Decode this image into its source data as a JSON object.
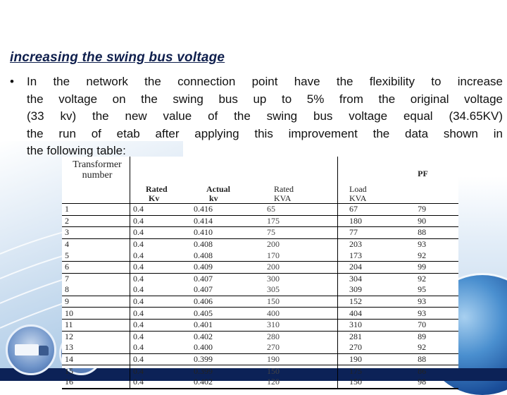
{
  "slide": {
    "title": "increasing the swing bus voltage",
    "bullet": {
      "symbol": "•",
      "lines": [
        "In the network the connection point have the flexibility to increase",
        "the voltage on the swing bus up to 5% from the original voltage",
        "(33 kv) the new value of the swing bus voltage equal (34.65KV)",
        "the run of etab after applying this improvement the data shown in",
        "the following table:"
      ]
    },
    "colors": {
      "title": "#0f1f4d",
      "bottom_band": "#0c2257"
    },
    "decorations": [
      "truck-badge",
      "globe",
      "light-arcs"
    ]
  },
  "table": {
    "headers": [
      {
        "line1": "Transformer",
        "line2": "number"
      },
      {
        "line1": "Rated",
        "line2": "Kv"
      },
      {
        "line1": "Actual",
        "line2": "kv"
      },
      {
        "line1": "Rated",
        "line2": "KVA"
      },
      {
        "line1": "Load",
        "line2": "KVA"
      },
      {
        "line1": "PF",
        "line2": ""
      }
    ],
    "rows": [
      [
        "1",
        "0.4",
        "0.416",
        "65",
        "67",
        "79"
      ],
      [
        "2",
        "0.4",
        "0.414",
        "175",
        "180",
        "90"
      ],
      [
        "3",
        "0.4",
        "0.410",
        "75",
        "77",
        "88"
      ],
      [
        "4",
        "0.4",
        "0.408",
        "200",
        "203",
        "93"
      ],
      [
        "5",
        "0.4",
        "0.408",
        "170",
        "173",
        "92"
      ],
      [
        "6",
        "0.4",
        "0.409",
        "200",
        "204",
        "99"
      ],
      [
        "7",
        "0.4",
        "0.407",
        "300",
        "304",
        "92"
      ],
      [
        "8",
        "0.4",
        "0.407",
        "305",
        "309",
        "95"
      ],
      [
        "9",
        "0.4",
        "0.406",
        "150",
        "152",
        "93"
      ],
      [
        "10",
        "0.4",
        "0.405",
        "400",
        "404",
        "93"
      ],
      [
        "11",
        "0.4",
        "0.401",
        "310",
        "310",
        "70"
      ],
      [
        "12",
        "0.4",
        "0.402",
        "280",
        "281",
        "89"
      ],
      [
        "13",
        "0.4",
        "0.400",
        "270",
        "270",
        "92"
      ],
      [
        "14",
        "0.4",
        "0.399",
        "190",
        "190",
        "88"
      ],
      [
        "15",
        "0.4",
        "0.399",
        "150",
        "175",
        "86"
      ],
      [
        "16",
        "0.4",
        "0.402",
        "120",
        "150",
        "98"
      ]
    ]
  }
}
